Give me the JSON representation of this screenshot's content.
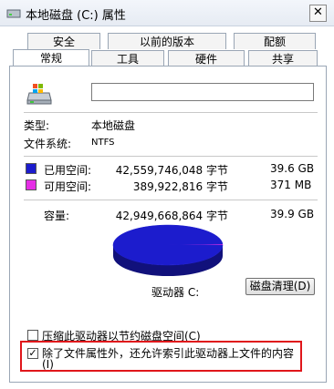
{
  "window": {
    "title": "本地磁盘 (C:) 属性",
    "close_label": "✕"
  },
  "tabs_row1": [
    "安全",
    "以前的版本",
    "配额"
  ],
  "tabs_row2": [
    "常规",
    "工具",
    "硬件",
    "共享"
  ],
  "active_tab": "常规",
  "general": {
    "name_value": "",
    "type_label": "类型:",
    "type_value": "本地磁盘",
    "fs_label": "文件系统:",
    "fs_value": "NTFS",
    "used": {
      "label": "已用空间:",
      "bytes": "42,559,746,048 字节",
      "size": "39.6 GB",
      "color": "#1c1ccd"
    },
    "free": {
      "label": "可用空间:",
      "bytes": "389,922,816 字节",
      "size": "371 MB",
      "color": "#e62ee6"
    },
    "capacity": {
      "label": "容量:",
      "bytes": "42,949,668,864 字节",
      "size": "39.9 GB"
    },
    "drive_label": "驱动器 C:",
    "cleanup_button": "磁盘清理(D)",
    "compress_label": "压缩此驱动器以节约磁盘空间(C)",
    "compress_checked": false,
    "index_label_line1": "除了文件属性外，还允许索引此驱动器上文件的内容",
    "index_label_line2": "(I)",
    "index_checked": true
  },
  "chart_data": {
    "type": "pie",
    "labels": [
      "已用空间",
      "可用空间"
    ],
    "values": [
      42559746048,
      389922816
    ],
    "colors": [
      "#1c1ccd",
      "#e62ee6"
    ]
  }
}
